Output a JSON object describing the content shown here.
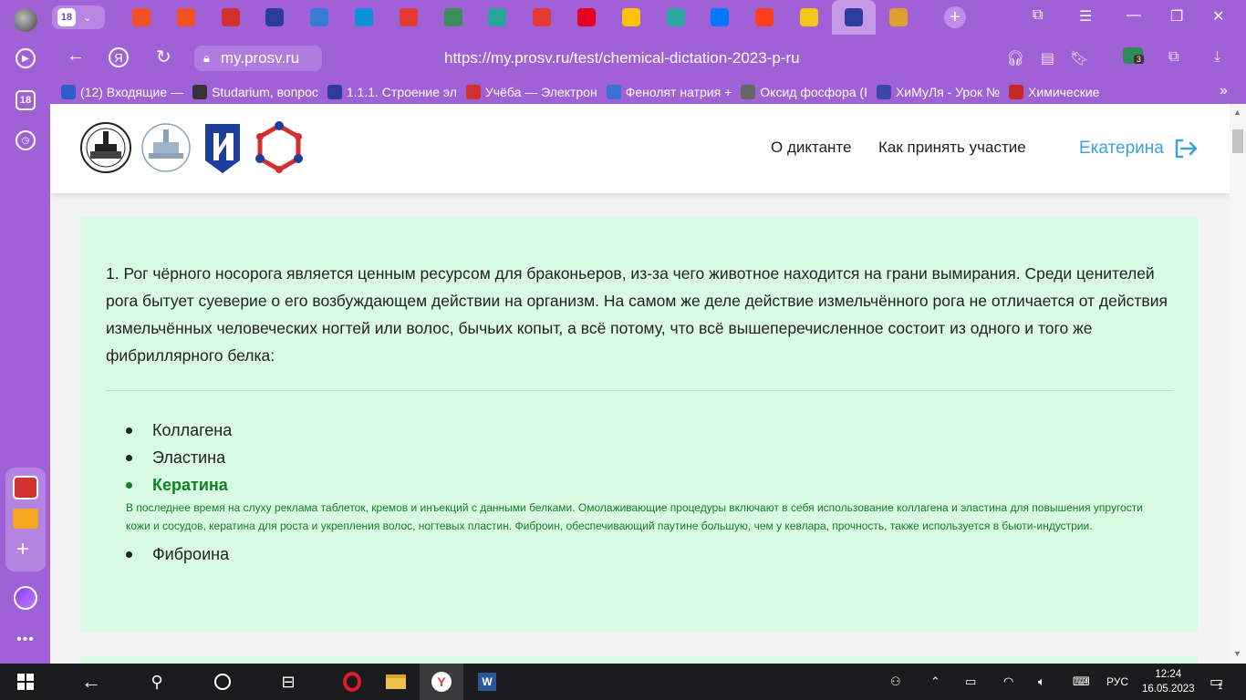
{
  "browser": {
    "tab_count": "18",
    "side_badge": "18",
    "url_domain": "my.prosv.ru",
    "url_full": "https://my.prosv.ru/test/chemical-dictation-2023-p-ru",
    "extension_badge": "3",
    "tab_favicon_colors": [
      "#f25022",
      "#f25022",
      "#d32f2f",
      "#2b3c9b",
      "#3a7bd5",
      "#0a8fd8",
      "#e53935",
      "#3c8d5a",
      "#26a69a",
      "#e53935",
      "#e60023",
      "#ffc107",
      "#2aa8a0",
      "#0077ff",
      "#fc3f1d",
      "#f5c518",
      "#2b3c9b",
      "#e0a030"
    ],
    "bookmarks": [
      {
        "label": "(12) Входящие — ",
        "color": "#2b5ec9"
      },
      {
        "label": "Studarium, вопрос",
        "color": "#333333"
      },
      {
        "label": "1.1.1. Строение эл",
        "color": "#2b3c9b"
      },
      {
        "label": "Учёба — Электрон",
        "color": "#d32f2f"
      },
      {
        "label": "Фенолят натрия +",
        "color": "#3a6fd8"
      },
      {
        "label": "Оксид фосфора (I",
        "color": "#666666"
      },
      {
        "label": "ХиМуЛя - Урок №",
        "color": "#3949ab"
      },
      {
        "label": "Химические",
        "color": "#c62828"
      }
    ],
    "bookmarks_more": "»"
  },
  "site": {
    "nav_about": "О диктанте",
    "nav_how": "Как принять участие",
    "user_name": "Екатерина"
  },
  "question": {
    "text": "1. Рог чёрного носорога является ценным ресурсом для браконьеров, из-за чего животное находится на грани вымирания. Среди ценителей рога бытует суеверие о его возбуждающем действии на организм. На самом же деле действие измельчённого рога не отличается от действия измельчённых человеческих ногтей или волос, бычьих копыт, а всё потому, что всё вышеперечисленное состоит из одного и того же фибриллярного белка:",
    "options": [
      {
        "label": "Коллагена",
        "correct": false
      },
      {
        "label": "Эластина",
        "correct": false
      },
      {
        "label": "Кератина",
        "correct": true
      },
      {
        "label": "Фиброина",
        "correct": false
      }
    ],
    "explanation": "В последнее время на слуху реклама таблеток, кремов и инъекций с данными белками. Омолаживающие процедуры включают в себя использование коллагена и эластина для повышения упругости кожи и сосудов, кератина для роста и укрепления волос, ногтевых пластин. Фиброин, обеспечивающий паутине большую, чем у кевлара, прочность, также используется в бьюти-индустрии."
  },
  "taskbar": {
    "language": "РУС",
    "time": "12:24",
    "date": "16.05.2023",
    "notifications": "1"
  }
}
